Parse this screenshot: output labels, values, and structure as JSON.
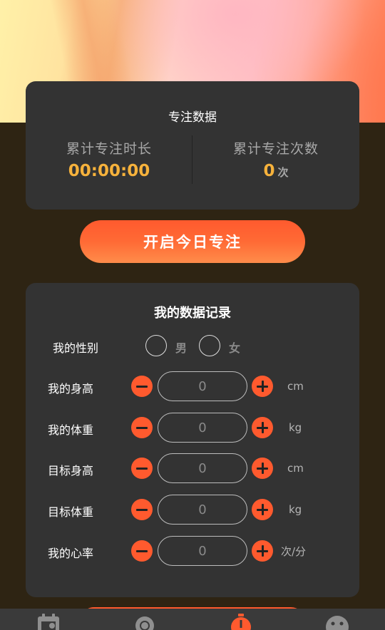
{
  "focus": {
    "title": "专注数据",
    "total_duration_label": "累计专注时长",
    "total_duration_value": "00:00:00",
    "total_count_label": "累计专注次数",
    "total_count_value": "0",
    "total_count_unit": "次"
  },
  "start_button_label": "开启今日专注",
  "records": {
    "title": "我的数据记录",
    "gender": {
      "label": "我的性别",
      "male": "男",
      "female": "女"
    },
    "height": {
      "label": "我的身高",
      "placeholder": "0",
      "unit": "cm"
    },
    "weight": {
      "label": "我的体重",
      "placeholder": "0",
      "unit": "kg"
    },
    "target_height": {
      "label": "目标身高",
      "placeholder": "0",
      "unit": "cm"
    },
    "target_weight": {
      "label": "目标体重",
      "placeholder": "0",
      "unit": "kg"
    },
    "heart_rate": {
      "label": "我的心率",
      "placeholder": "0",
      "unit": "次/分"
    }
  },
  "tabbar": {
    "items": [
      {
        "icon": "calendar-icon"
      },
      {
        "icon": "sun-icon"
      },
      {
        "icon": "stopwatch-icon",
        "active": true
      },
      {
        "icon": "face-icon"
      }
    ],
    "active_color": "#ff5a2e",
    "inactive_color": "#8f8f8f"
  },
  "colors": {
    "accent": "#ff5a2e",
    "highlight": "#f6b23c",
    "card": "#333333",
    "background": "#2e2413"
  }
}
